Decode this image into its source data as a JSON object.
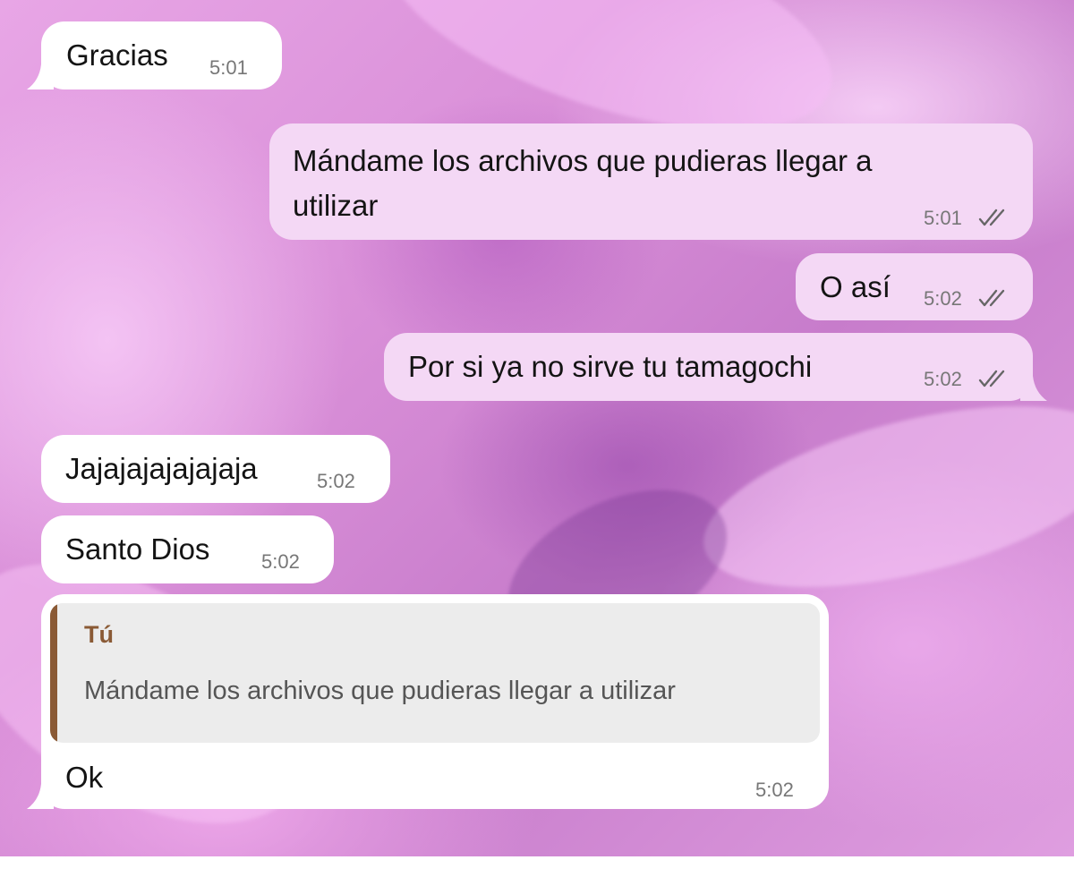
{
  "messages": [
    {
      "text": "Gracias",
      "time": "5:01"
    },
    {
      "lines": [
        "Mándame los archivos que pudieras llegar a",
        "utilizar"
      ],
      "time": "5:01",
      "status": "read-double-check-icon"
    },
    {
      "text": "O así",
      "time": "5:02",
      "status": "read-double-check-icon"
    },
    {
      "text": "Por si ya no sirve tu tamagochi",
      "time": "5:02",
      "status": "read-double-check-icon"
    },
    {
      "text": "Jajajajajajajaja",
      "time": "5:02"
    },
    {
      "text": "Santo Dios",
      "time": "5:02"
    },
    {
      "quote": {
        "author": "Tú",
        "text": "Mándame los archivos que pudieras llegar a utilizar"
      },
      "text": "Ok",
      "time": "5:02"
    }
  ],
  "colors": {
    "incoming_bubble": "#ffffff",
    "outgoing_bubble": "#f4d8f5",
    "quote_accent": "#8a5a35",
    "quote_background": "#ececec"
  }
}
